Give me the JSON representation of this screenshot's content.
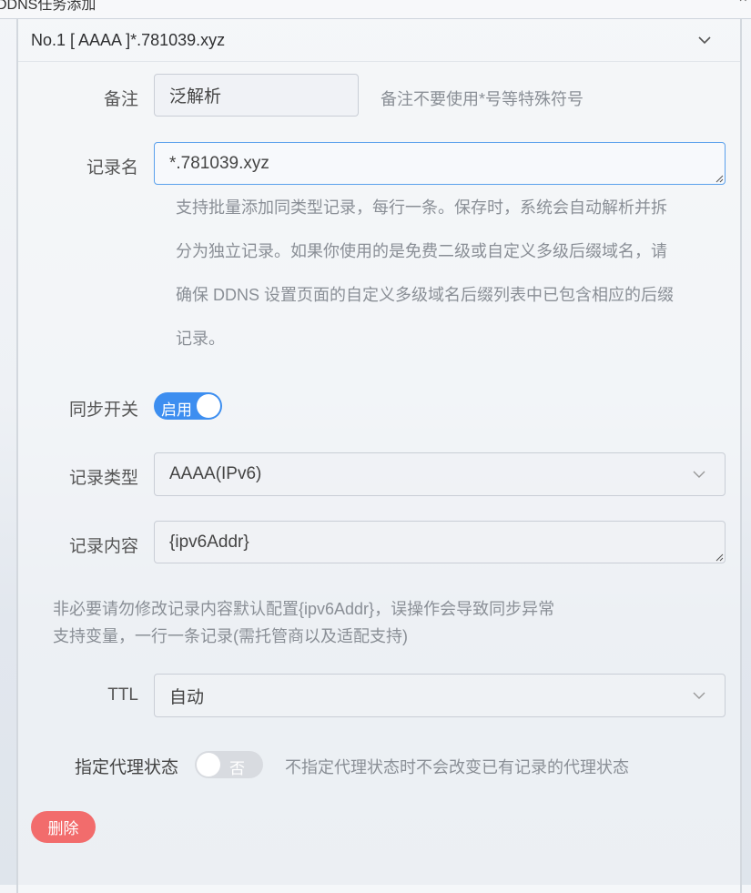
{
  "dialog": {
    "title": "DDNS任务添加",
    "close_label": "×"
  },
  "record": {
    "header": "No.1 [ AAAA ]*.781039.xyz",
    "remark": {
      "label": "备注",
      "value": "泛解析",
      "hint": "备注不要使用*号等特殊符号"
    },
    "record_name": {
      "label": "记录名",
      "value": "*.781039.xyz",
      "help_lines": [
        "支持批量添加同类型记录，每行一条。保存时，系统会自动解析并拆",
        "分为独立记录。如果你使用的是免费二级或自定义多级后缀域名，请",
        "确保 DDNS 设置页面的自定义多级域名后缀列表中已包含相应的后缀",
        "记录。"
      ]
    },
    "sync_switch": {
      "label": "同步开关",
      "state_text": "启用",
      "on": true
    },
    "record_type": {
      "label": "记录类型",
      "value": "AAAA(IPv6)"
    },
    "record_content": {
      "label": "记录内容",
      "value": "{ipv6Addr}",
      "help_lines": [
        "非必要请勿修改记录内容默认配置{ipv6Addr}，误操作会导致同步异常",
        "支持变量，一行一条记录(需托管商以及适配支持)"
      ]
    },
    "ttl": {
      "label": "TTL",
      "value": "自动"
    },
    "proxy_state": {
      "label": "指定代理状态",
      "state_text": "否",
      "on": false,
      "hint": "不指定代理状态时不会改变已有记录的代理状态"
    },
    "delete_label": "删除"
  },
  "colors": {
    "accent": "#3d8ef0",
    "danger": "#f26c6c",
    "focus_border": "#5aa0ec"
  }
}
